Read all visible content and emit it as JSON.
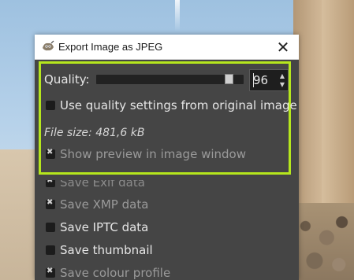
{
  "window": {
    "title": "Export Image as JPEG",
    "close_glyph": "✕"
  },
  "quality": {
    "label": "Quality:",
    "value": "96",
    "slider_fraction": 0.96
  },
  "options": {
    "use_original": {
      "label": "Use quality settings from original image",
      "checked": false
    },
    "file_size": "File size: 481,6 kB",
    "show_preview": {
      "label": "Show preview in image window",
      "checked": true
    },
    "save_exif": {
      "label": "Save Exif data",
      "checked": true
    },
    "save_xmp": {
      "label": "Save XMP data",
      "checked": true
    },
    "save_iptc": {
      "label": "Save IPTC data",
      "checked": false
    },
    "save_thumbnail": {
      "label": "Save thumbnail",
      "checked": false
    },
    "save_colour_profile": {
      "label": "Save colour profile",
      "checked": true
    }
  },
  "colors": {
    "highlight": "#b5e61d",
    "dialog_bg": "#454545"
  },
  "icons": {
    "app": "gimp-icon",
    "close": "close-icon"
  }
}
